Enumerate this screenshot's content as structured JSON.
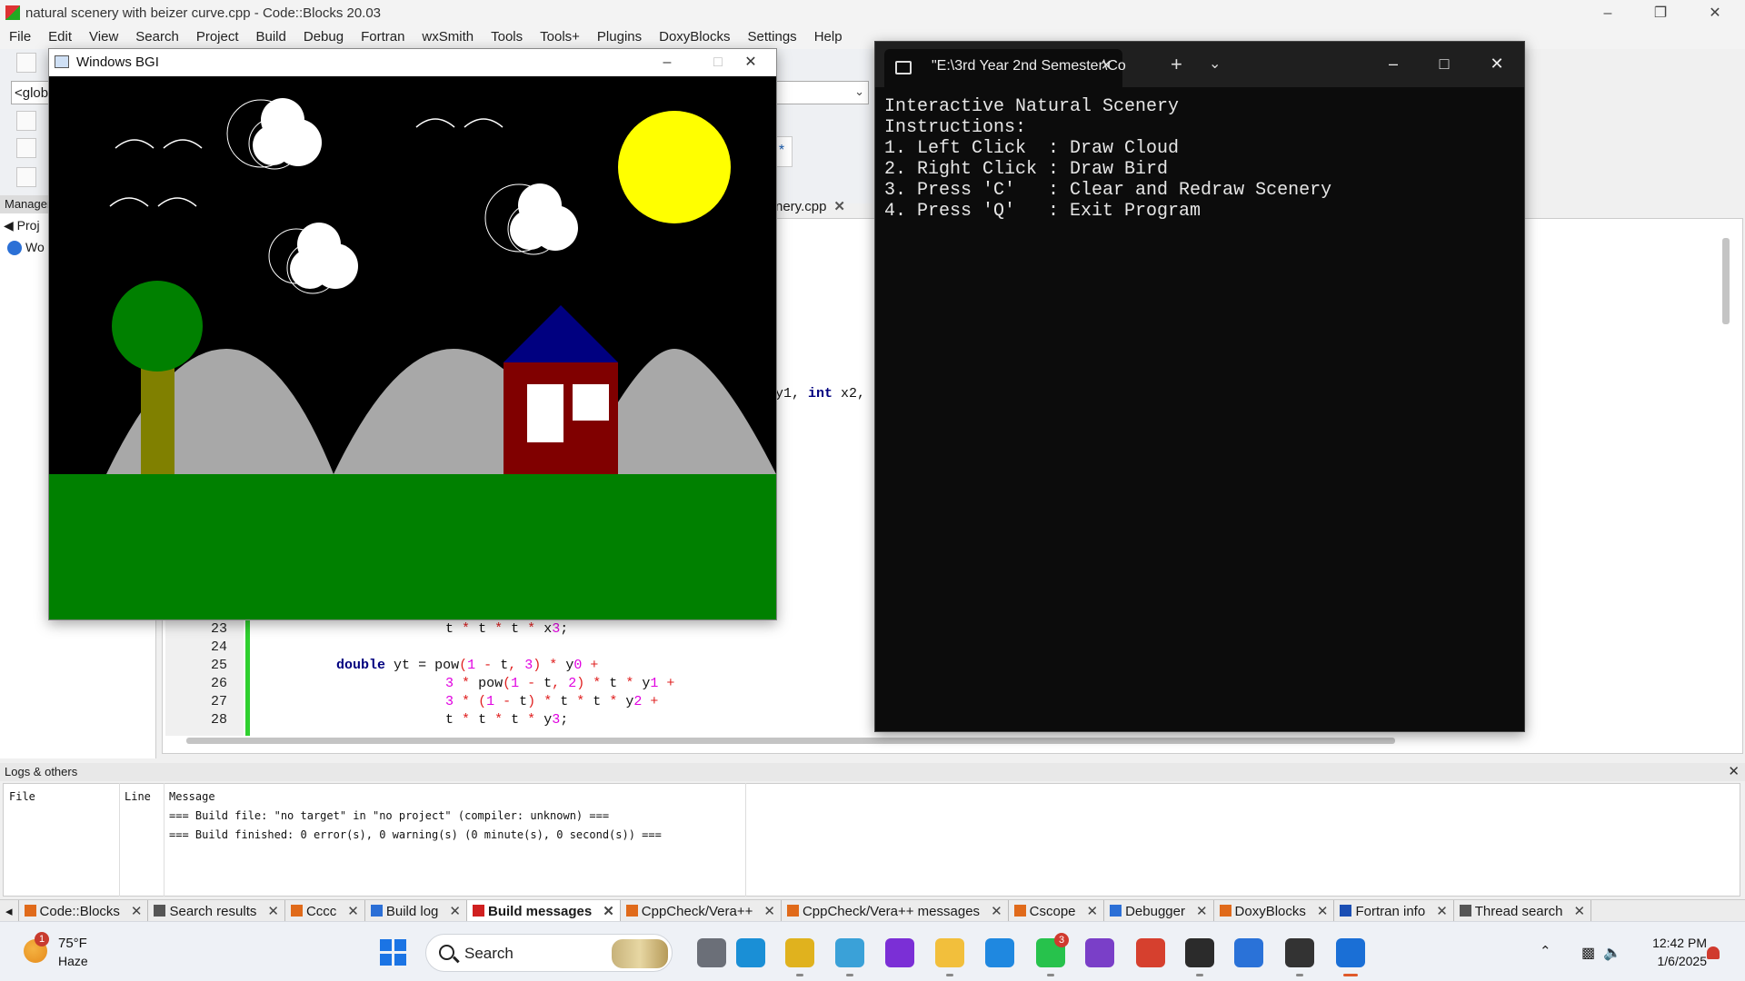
{
  "codeblocks": {
    "title": "natural scenery with beizer curve.cpp - Code::Blocks 20.03",
    "menu": [
      "File",
      "Edit",
      "View",
      "Search",
      "Project",
      "Build",
      "Debug",
      "Fortran",
      "wxSmith",
      "Tools",
      "Tools+",
      "Plugins",
      "DoxyBlocks",
      "Settings",
      "Help"
    ],
    "global_combo": "<glob",
    "management_label": "Manager",
    "projects_tab": "Proj",
    "workspace_item": "Wo",
    "file_tab": "nery.cpp",
    "star_tab": "*",
    "partial_code": "y1, int x2,",
    "line_numbers": [
      "23",
      "24",
      "25",
      "26",
      "27",
      "28"
    ],
    "code_lines": [
      "t * t * t * x3;",
      "",
      "double yt = pow(1 - t, 3) * y0 +",
      "3 * pow(1 - t, 2) * t * y1 +",
      "3 * (1 - t) * t * t * y2 +",
      "t * t * t * y3;"
    ]
  },
  "logs": {
    "header": "Logs & others",
    "columns": [
      "File",
      "Line",
      "Message"
    ],
    "messages": [
      "=== Build file: \"no target\" in \"no project\" (compiler: unknown) ===",
      "=== Build finished: 0 error(s), 0 warning(s) (0 minute(s), 0 second(s)) ==="
    ],
    "tabs": [
      {
        "label": "Code::Blocks",
        "icon_color": "#e06a1a"
      },
      {
        "label": "Search results",
        "icon_color": "#555555"
      },
      {
        "label": "Cccc",
        "icon_color": "#e06a1a"
      },
      {
        "label": "Build log",
        "icon_color": "#2b6fd6"
      },
      {
        "label": "Build messages",
        "icon_color": "#d02020",
        "active": true
      },
      {
        "label": "CppCheck/Vera++",
        "icon_color": "#e06a1a"
      },
      {
        "label": "CppCheck/Vera++ messages",
        "icon_color": "#e06a1a"
      },
      {
        "label": "Cscope",
        "icon_color": "#e06a1a"
      },
      {
        "label": "Debugger",
        "icon_color": "#2b6fd6"
      },
      {
        "label": "DoxyBlocks",
        "icon_color": "#e06a1a"
      },
      {
        "label": "Fortran info",
        "icon_color": "#1b4fb4"
      },
      {
        "label": "Thread search",
        "icon_color": "#555555"
      }
    ]
  },
  "bgi": {
    "title": "Windows BGI"
  },
  "terminal": {
    "tab_title": "\"E:\\3rd Year 2nd Semester\\Co",
    "output": [
      "Interactive Natural Scenery",
      "Instructions:",
      "1. Left Click  : Draw Cloud",
      "2. Right Click : Draw Bird",
      "3. Press 'C'   : Clear and Redraw Scenery",
      "4. Press 'Q'   : Exit Program"
    ]
  },
  "taskbar": {
    "weather_temp": "75°F",
    "weather_desc": "Haze",
    "weather_badge": "1",
    "search_placeholder": "Search",
    "whatsapp_badge": "3",
    "time": "12:42 PM",
    "date": "1/6/2025"
  },
  "colors": {
    "sky": "#000000",
    "sun": "#ffff00",
    "grass": "#008000",
    "hills": "#a8a8a8",
    "house": "#800000",
    "roof": "#000080",
    "tree_foliage": "#008000",
    "tree_trunk": "#808000"
  }
}
